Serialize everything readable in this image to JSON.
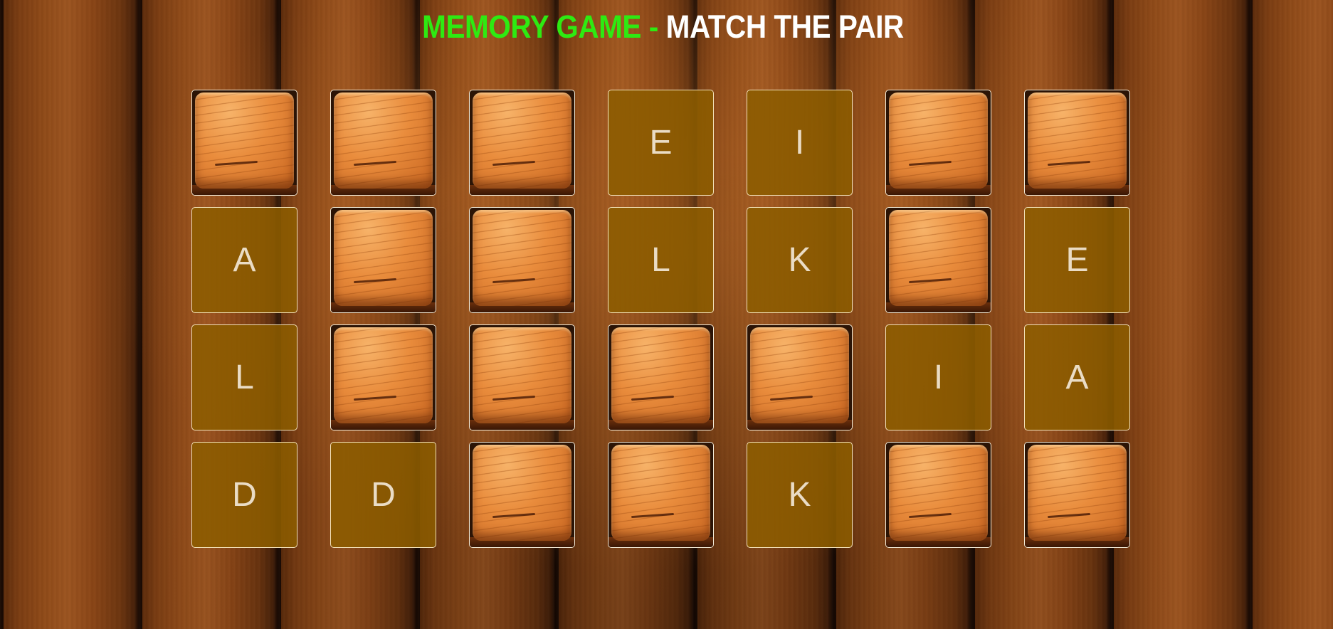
{
  "header": {
    "title_part1": "MEMORY GAME",
    "separator": "-",
    "title_part2": "MATCH THE PAIR"
  },
  "colors": {
    "title_accent": "#2eea12",
    "title_main": "#ffffff",
    "revealed_card": "#8c5c00"
  },
  "board": {
    "columns": 7,
    "rows": 4,
    "cards": [
      {
        "state": "hidden",
        "letter": ""
      },
      {
        "state": "hidden",
        "letter": ""
      },
      {
        "state": "hidden",
        "letter": ""
      },
      {
        "state": "revealed",
        "letter": "E"
      },
      {
        "state": "revealed",
        "letter": "I"
      },
      {
        "state": "hidden",
        "letter": ""
      },
      {
        "state": "hidden",
        "letter": ""
      },
      {
        "state": "revealed",
        "letter": "A"
      },
      {
        "state": "hidden",
        "letter": ""
      },
      {
        "state": "hidden",
        "letter": ""
      },
      {
        "state": "revealed",
        "letter": "L"
      },
      {
        "state": "revealed",
        "letter": "K"
      },
      {
        "state": "hidden",
        "letter": ""
      },
      {
        "state": "revealed",
        "letter": "E"
      },
      {
        "state": "revealed",
        "letter": "L"
      },
      {
        "state": "hidden",
        "letter": ""
      },
      {
        "state": "hidden",
        "letter": ""
      },
      {
        "state": "hidden",
        "letter": ""
      },
      {
        "state": "hidden",
        "letter": ""
      },
      {
        "state": "revealed",
        "letter": "I"
      },
      {
        "state": "revealed",
        "letter": "A"
      },
      {
        "state": "revealed",
        "letter": "D"
      },
      {
        "state": "revealed",
        "letter": "D"
      },
      {
        "state": "hidden",
        "letter": ""
      },
      {
        "state": "hidden",
        "letter": ""
      },
      {
        "state": "revealed",
        "letter": "K"
      },
      {
        "state": "hidden",
        "letter": ""
      },
      {
        "state": "hidden",
        "letter": ""
      }
    ]
  }
}
